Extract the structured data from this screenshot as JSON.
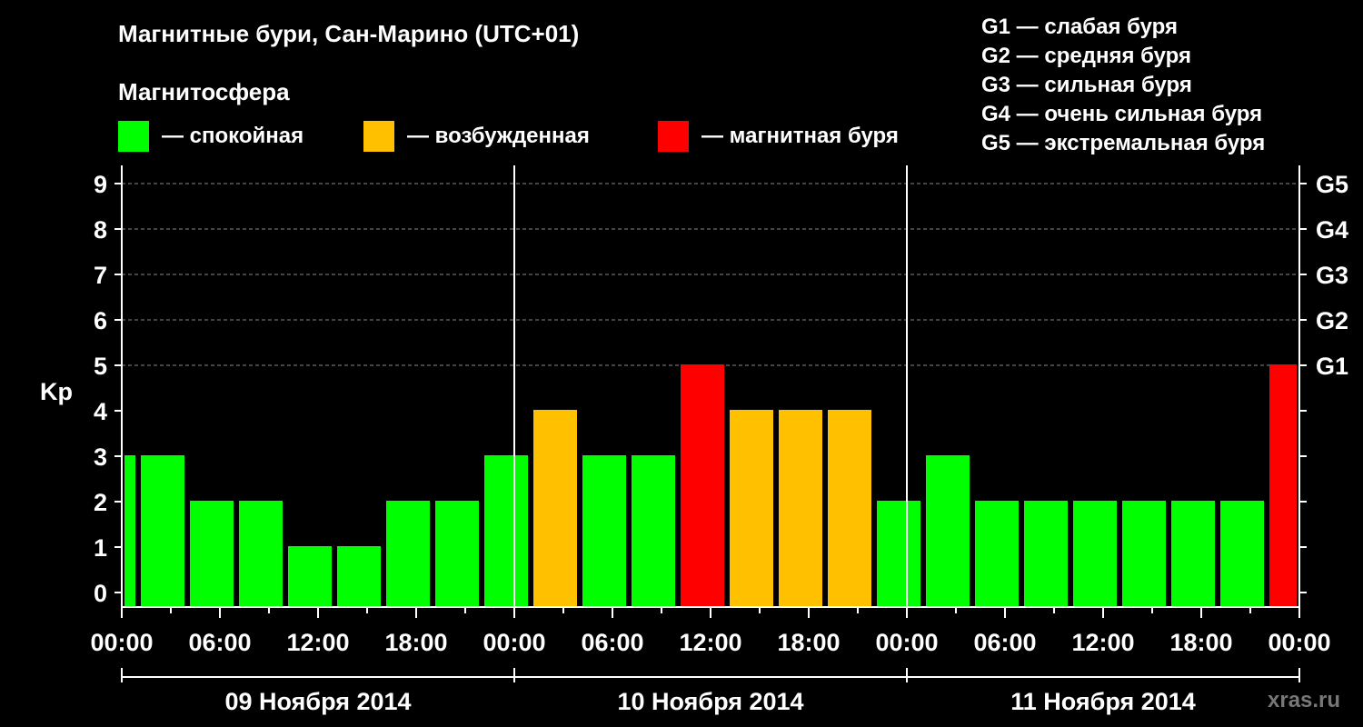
{
  "title": "Магнитные бури, Сан-Марино (UTC+01)",
  "subtitle": "Магнитосфера",
  "legend": [
    {
      "label": "— спокойная",
      "color": "#00ff00"
    },
    {
      "label": "— возбужденная",
      "color": "#ffc000"
    },
    {
      "label": "— магнитная буря",
      "color": "#ff0000"
    }
  ],
  "g_scale": [
    "G1 — слабая буря",
    "G2 — средняя буря",
    "G3 — сильная буря",
    "G4 — очень сильная буря",
    "G5 — экстремальная буря"
  ],
  "watermark": "xras.ru",
  "chart_data": {
    "type": "bar",
    "ylabel": "Kp",
    "ylim": [
      0,
      9
    ],
    "yticks": [
      "0",
      "1",
      "2",
      "3",
      "4",
      "5",
      "6",
      "7",
      "8",
      "9"
    ],
    "right_ticks": [
      {
        "value": 5,
        "label": "G1"
      },
      {
        "value": 6,
        "label": "G2"
      },
      {
        "value": 7,
        "label": "G3"
      },
      {
        "value": 8,
        "label": "G4"
      },
      {
        "value": 9,
        "label": "G5"
      }
    ],
    "x_tick_labels": [
      "00:00",
      "06:00",
      "12:00",
      "18:00",
      "00:00",
      "06:00",
      "12:00",
      "18:00",
      "00:00",
      "06:00",
      "12:00",
      "18:00",
      "00:00"
    ],
    "days": [
      "09 Ноября 2014",
      "10 Ноября 2014",
      "11 Ноября 2014"
    ],
    "grid": "horizontal dashed at Kp 5–9",
    "colors": {
      "quiet": "#00ff00",
      "excited": "#ffc000",
      "storm": "#ff0000"
    },
    "bars": [
      {
        "start_hour": 0,
        "end_hour": 1,
        "kp": 3,
        "level": "quiet"
      },
      {
        "start_hour": 1,
        "end_hour": 4,
        "kp": 3,
        "level": "quiet"
      },
      {
        "start_hour": 4,
        "end_hour": 7,
        "kp": 2,
        "level": "quiet"
      },
      {
        "start_hour": 7,
        "end_hour": 10,
        "kp": 2,
        "level": "quiet"
      },
      {
        "start_hour": 10,
        "end_hour": 13,
        "kp": 1,
        "level": "quiet"
      },
      {
        "start_hour": 13,
        "end_hour": 16,
        "kp": 1,
        "level": "quiet"
      },
      {
        "start_hour": 16,
        "end_hour": 19,
        "kp": 2,
        "level": "quiet"
      },
      {
        "start_hour": 19,
        "end_hour": 22,
        "kp": 2,
        "level": "quiet"
      },
      {
        "start_hour": 22,
        "end_hour": 25,
        "kp": 3,
        "level": "quiet"
      },
      {
        "start_hour": 25,
        "end_hour": 28,
        "kp": 4,
        "level": "excited"
      },
      {
        "start_hour": 28,
        "end_hour": 31,
        "kp": 3,
        "level": "quiet"
      },
      {
        "start_hour": 31,
        "end_hour": 34,
        "kp": 3,
        "level": "quiet"
      },
      {
        "start_hour": 34,
        "end_hour": 37,
        "kp": 5,
        "level": "storm"
      },
      {
        "start_hour": 37,
        "end_hour": 40,
        "kp": 4,
        "level": "excited"
      },
      {
        "start_hour": 40,
        "end_hour": 43,
        "kp": 4,
        "level": "excited"
      },
      {
        "start_hour": 43,
        "end_hour": 46,
        "kp": 4,
        "level": "excited"
      },
      {
        "start_hour": 46,
        "end_hour": 49,
        "kp": 2,
        "level": "quiet"
      },
      {
        "start_hour": 49,
        "end_hour": 52,
        "kp": 3,
        "level": "quiet"
      },
      {
        "start_hour": 52,
        "end_hour": 55,
        "kp": 2,
        "level": "quiet"
      },
      {
        "start_hour": 55,
        "end_hour": 58,
        "kp": 2,
        "level": "quiet"
      },
      {
        "start_hour": 58,
        "end_hour": 61,
        "kp": 2,
        "level": "quiet"
      },
      {
        "start_hour": 61,
        "end_hour": 64,
        "kp": 2,
        "level": "quiet"
      },
      {
        "start_hour": 64,
        "end_hour": 67,
        "kp": 2,
        "level": "quiet"
      },
      {
        "start_hour": 67,
        "end_hour": 70,
        "kp": 2,
        "level": "quiet"
      },
      {
        "start_hour": 70,
        "end_hour": 72,
        "kp": 5,
        "level": "storm"
      }
    ]
  }
}
